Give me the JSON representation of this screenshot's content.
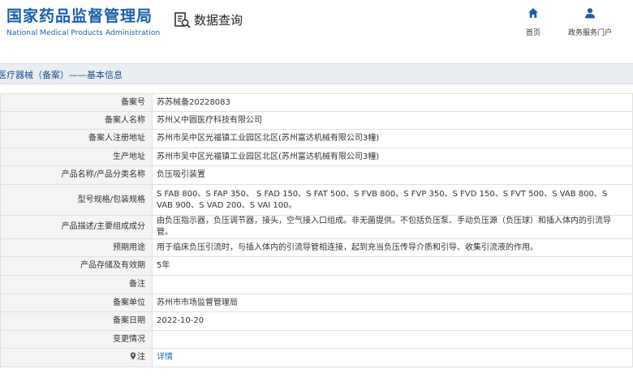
{
  "header": {
    "brand_cn": "国家药品监督管理局",
    "brand_en": "National Medical Products Administration",
    "query_label": "数据查询",
    "nav": [
      {
        "label": "首页",
        "icon": "home-icon"
      },
      {
        "label": "政务服务门户",
        "icon": "user-icon"
      }
    ]
  },
  "section": {
    "title": "医疗器械（备案）——基本信息"
  },
  "rows": [
    {
      "label": "备案号",
      "value": "苏苏械备20228083"
    },
    {
      "label": "备案人名称",
      "value": "苏州乂中圆医疗科技有限公司"
    },
    {
      "label": "备案人注册地址",
      "value": "苏州市吴中区光福镇工业园区北区(苏州富达机械有限公司3幢)"
    },
    {
      "label": "生产地址",
      "value": "苏州市吴中区光福镇工业园区北区(苏州富达机械有限公司3幢)"
    },
    {
      "label": "产品名称/产品分类名称",
      "value": "负压吸引装置"
    },
    {
      "label": "型号规格/包装规格",
      "value": "S FAB 800、S FAP 350、 S FAD 150、S FAT 500、S FVB 800、S FVP 350、S FVD 150、S FVT 500、S VAB 800、S VAB 900、S VAD 200、S VAI 100。"
    },
    {
      "label": "产品描述/主要组成成分",
      "value": "由负压指示器，负压调节器，接头，空气接入口组成。非无菌提供。不包括负压泵、手动负压源（负压球）和插入体内的引流导管。"
    },
    {
      "label": "预期用途",
      "value": "用于临床负压引流时，与插入体内的引流导管相连接，起到充当负压传导介质和引导、收集引流液的作用。"
    },
    {
      "label": "产品存储及有效期",
      "value": "5年"
    },
    {
      "label": "备注",
      "value": ""
    },
    {
      "label": "备案单位",
      "value": "苏州市市场监督管理局"
    },
    {
      "label": "备案日期",
      "value": "2022-10-20"
    },
    {
      "label": "变更情况",
      "value": ""
    },
    {
      "label": "注",
      "value": "详情"
    }
  ],
  "colors": {
    "brand": "#1b5fa8",
    "link": "#1b6bbf",
    "label_bg": "#f4f4f4",
    "section_bg": "#e9eef3"
  }
}
